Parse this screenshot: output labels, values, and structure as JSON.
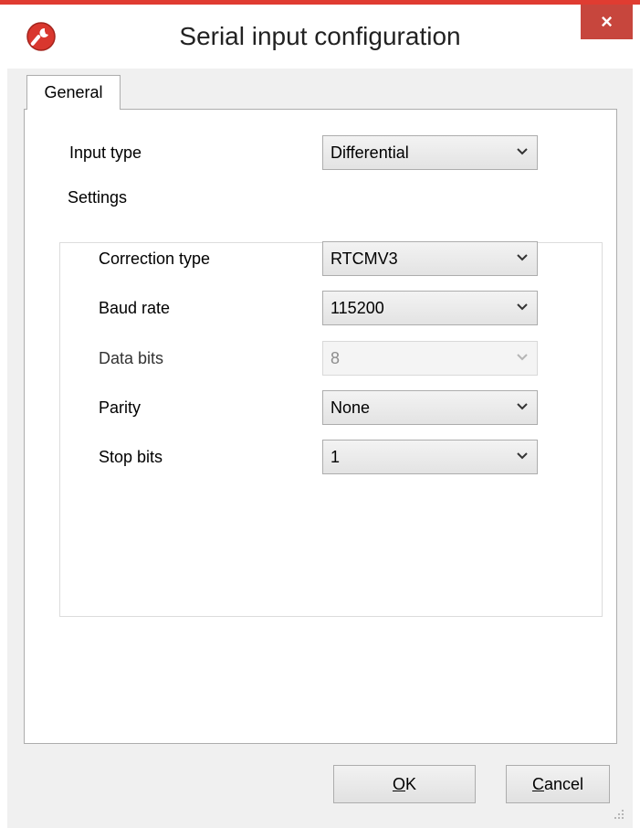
{
  "window": {
    "title": "Serial input configuration",
    "accent_color": "#e03c31",
    "close_button_color": "#c7463d",
    "app_icon": "wrench-app-icon",
    "close_icon": "×"
  },
  "tabs": [
    {
      "label": "General",
      "selected": true
    }
  ],
  "general": {
    "input_type": {
      "label": "Input type",
      "value": "Differential"
    },
    "settings": {
      "title": "Settings",
      "correction_type": {
        "label": "Correction type",
        "value": "RTCMV3"
      },
      "baud_rate": {
        "label": "Baud rate",
        "value": "115200"
      },
      "data_bits": {
        "label": "Data bits",
        "value": "8",
        "disabled": true
      },
      "parity": {
        "label": "Parity",
        "value": "None"
      },
      "stop_bits": {
        "label": "Stop bits",
        "value": "1"
      }
    }
  },
  "buttons": {
    "ok": {
      "label": "OK",
      "mnemonic": "O",
      "rest": "K"
    },
    "cancel": {
      "label": "Cancel",
      "mnemonic": "C",
      "rest": "ancel"
    }
  }
}
